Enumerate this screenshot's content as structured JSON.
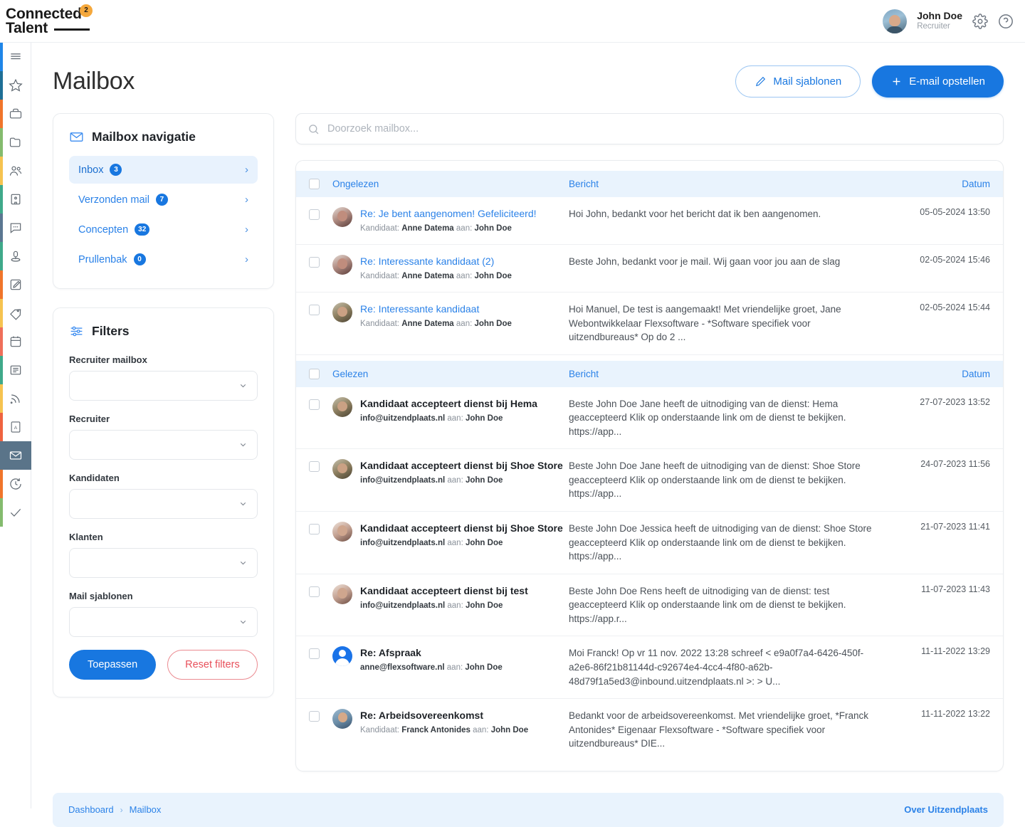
{
  "brand": {
    "line1": "Connected",
    "line2": "Talent",
    "badge": "2"
  },
  "header": {
    "user_name": "John Doe",
    "user_role": "Recruiter",
    "settings_icon": "gear-icon",
    "help_icon": "help-circle-icon"
  },
  "rail": {
    "items": [
      {
        "icon": "menu-icon",
        "color": "#1f86e8",
        "active": false
      },
      {
        "icon": "star-icon",
        "color": "#1f6f96",
        "active": false
      },
      {
        "icon": "briefcase-icon",
        "color": "#f0752b",
        "active": false
      },
      {
        "icon": "folder-icon",
        "color": "#84bb6e",
        "active": false
      },
      {
        "icon": "users-icon",
        "color": "#f6c council",
        "active": false
      },
      {
        "icon": "building-icon",
        "color": "#3fa98a",
        "active": false
      },
      {
        "icon": "chat-icon",
        "color": "#5b7791",
        "active": false
      },
      {
        "icon": "candidate-icon",
        "color": "#3fa98a",
        "active": false
      },
      {
        "icon": "edit-icon",
        "color": "#f0752b",
        "active": false
      },
      {
        "icon": "tag-icon",
        "color": "#f6c350",
        "active": false
      },
      {
        "icon": "calendar-icon",
        "color": "#ef6f5a",
        "active": false
      },
      {
        "icon": "news-icon",
        "color": "#3fa98a",
        "active": false
      },
      {
        "icon": "rss-icon",
        "color": "#f6c350",
        "active": false
      },
      {
        "icon": "pdf-icon",
        "color": "#ef6340",
        "active": false
      },
      {
        "icon": "mail-icon",
        "color": "#5a7489",
        "active": true
      },
      {
        "icon": "history-icon",
        "color": "#f0752b",
        "active": false
      },
      {
        "icon": "check-icon",
        "color": "#84bb6e",
        "active": false
      }
    ]
  },
  "page": {
    "title": "Mailbox",
    "templates_button": "Mail sjablonen",
    "compose_button": "E-mail opstellen"
  },
  "nav_card": {
    "title": "Mailbox navigatie",
    "icon": "envelope-icon",
    "items": [
      {
        "label": "Inbox",
        "count": "3",
        "active": true
      },
      {
        "label": "Verzonden mail",
        "count": "7",
        "active": false
      },
      {
        "label": "Concepten",
        "count": "32",
        "active": false
      },
      {
        "label": "Prullenbak",
        "count": "0",
        "active": false
      }
    ]
  },
  "filters_card": {
    "title": "Filters",
    "icon": "sliders-icon",
    "fields": [
      {
        "label": "Recruiter mailbox",
        "value": ""
      },
      {
        "label": "Recruiter",
        "value": ""
      },
      {
        "label": "Kandidaten",
        "value": ""
      },
      {
        "label": "Klanten",
        "value": ""
      },
      {
        "label": "Mail sjablonen",
        "value": ""
      }
    ],
    "apply_button": "Toepassen",
    "reset_button": "Reset filters"
  },
  "search": {
    "placeholder": "Doorzoek mailbox...",
    "value": "",
    "icon": "search-icon"
  },
  "mail_list": {
    "groups": [
      {
        "head": {
          "label": "Ongelezen",
          "message": "Bericht",
          "date": "Datum"
        },
        "rows": [
          {
            "subject": "Re: Je bent aangenomen! Gefeliciteerd!",
            "sender_prefix": "Kandidaat:",
            "sender": "Anne Datema",
            "to_prefix": "aan:",
            "to": "John Doe",
            "preview": "Hoi John, bedankt voor het bericht dat ik ben aangenomen.",
            "date": "05-05-2024 13:50",
            "avatar": "avatar-anne"
          },
          {
            "subject": "Re: Interessante kandidaat (2)",
            "sender_prefix": "Kandidaat:",
            "sender": "Anne Datema",
            "to_prefix": "aan:",
            "to": "John Doe",
            "preview": "Beste John, bedankt voor je mail. Wij gaan voor jou aan de slag",
            "date": "02-05-2024 15:46",
            "avatar": "avatar-anne"
          },
          {
            "subject": "Re: Interessante kandidaat",
            "sender_prefix": "Kandidaat:",
            "sender": "Anne Datema",
            "to_prefix": "aan:",
            "to": "John Doe",
            "preview": "Hoi Manuel, De test is aangemaakt! Met vriendelijke groet, Jane Webontwikkelaar Flexsoftware - *Software specifiek voor uitzendbureaus* Op do 2 ...",
            "date": "02-05-2024 15:44",
            "avatar": "avatar-jane"
          }
        ]
      },
      {
        "head": {
          "label": "Gelezen",
          "message": "Bericht",
          "date": "Datum"
        },
        "rows": [
          {
            "subject": "Kandidaat accepteert dienst bij Hema",
            "sender_prefix": "",
            "sender": "info@uitzendplaats.nl",
            "to_prefix": "aan:",
            "to": "John Doe",
            "preview": "Beste John Doe Jane heeft de uitnodiging van de dienst: Hema geaccepteerd Klik op onderstaande link om de dienst te bekijken. https://app...",
            "date": "27-07-2023 13:52",
            "avatar": "avatar-jane"
          },
          {
            "subject": "Kandidaat accepteert dienst bij Shoe Store",
            "sender_prefix": "",
            "sender": "info@uitzendplaats.nl",
            "to_prefix": "aan:",
            "to": "John Doe",
            "preview": "Beste John Doe Jane heeft de uitnodiging van de dienst: Shoe Store geaccepteerd Klik op onderstaande link om de dienst te bekijken. https://app...",
            "date": "24-07-2023 11:56",
            "avatar": "avatar-jane"
          },
          {
            "subject": "Kandidaat accepteert dienst bij Shoe Store",
            "sender_prefix": "",
            "sender": "info@uitzendplaats.nl",
            "to_prefix": "aan:",
            "to": "John Doe",
            "preview": "Beste John Doe Jessica heeft de uitnodiging van de dienst: Shoe Store geaccepteerd Klik op onderstaande link om de dienst te bekijken. https://app...",
            "date": "21-07-2023 11:41",
            "avatar": "avatar-jessica"
          },
          {
            "subject": "Kandidaat accepteert dienst bij test",
            "sender_prefix": "",
            "sender": "info@uitzendplaats.nl",
            "to_prefix": "aan:",
            "to": "John Doe",
            "preview": "Beste John Doe Rens heeft de uitnodiging van de dienst: test geaccepteerd Klik op onderstaande link om de dienst te bekijken. https://app.r...",
            "date": "11-07-2023 11:43",
            "avatar": "avatar-rens"
          },
          {
            "subject": "Re: Afspraak",
            "sender_prefix": "",
            "sender": "anne@flexsoftware.nl",
            "to_prefix": "aan:",
            "to": "John Doe",
            "preview": "Moi Franck! Op vr 11 nov. 2022 13:28 schreef < e9a0f7a4-6426-450f-a2e6-86f21b81144d-c92674e4-4cc4-4f80-a62b-48d79f1a5ed3@inbound.uitzendplaats.nl >: > U...",
            "date": "11-11-2022 13:29",
            "avatar": "avatar-placeholder"
          },
          {
            "subject": "Re: Arbeidsovereenkomst",
            "sender_prefix": "Kandidaat:",
            "sender": "Franck Antonides",
            "to_prefix": "aan:",
            "to": "John Doe",
            "preview": "Bedankt voor de arbeidsovereenkomst. Met vriendelijke groet, *Franck Antonides* Eigenaar Flexsoftware - *Software specifiek voor uitzendbureaus* DIE...",
            "date": "11-11-2022 13:22",
            "avatar": "avatar-franck"
          }
        ]
      }
    ]
  },
  "footer": {
    "crumb_dashboard": "Dashboard",
    "crumb_sep": "›",
    "crumb_current": "Mailbox",
    "about_link": "Over Uitzendplaats"
  },
  "colors": {
    "primary": "#1877e0",
    "link": "#2b82e8",
    "danger": "#e8505b",
    "group_head_bg": "#e9f3fd",
    "rail_active": "#5a7489",
    "logo_badge": "#f5a83c"
  }
}
